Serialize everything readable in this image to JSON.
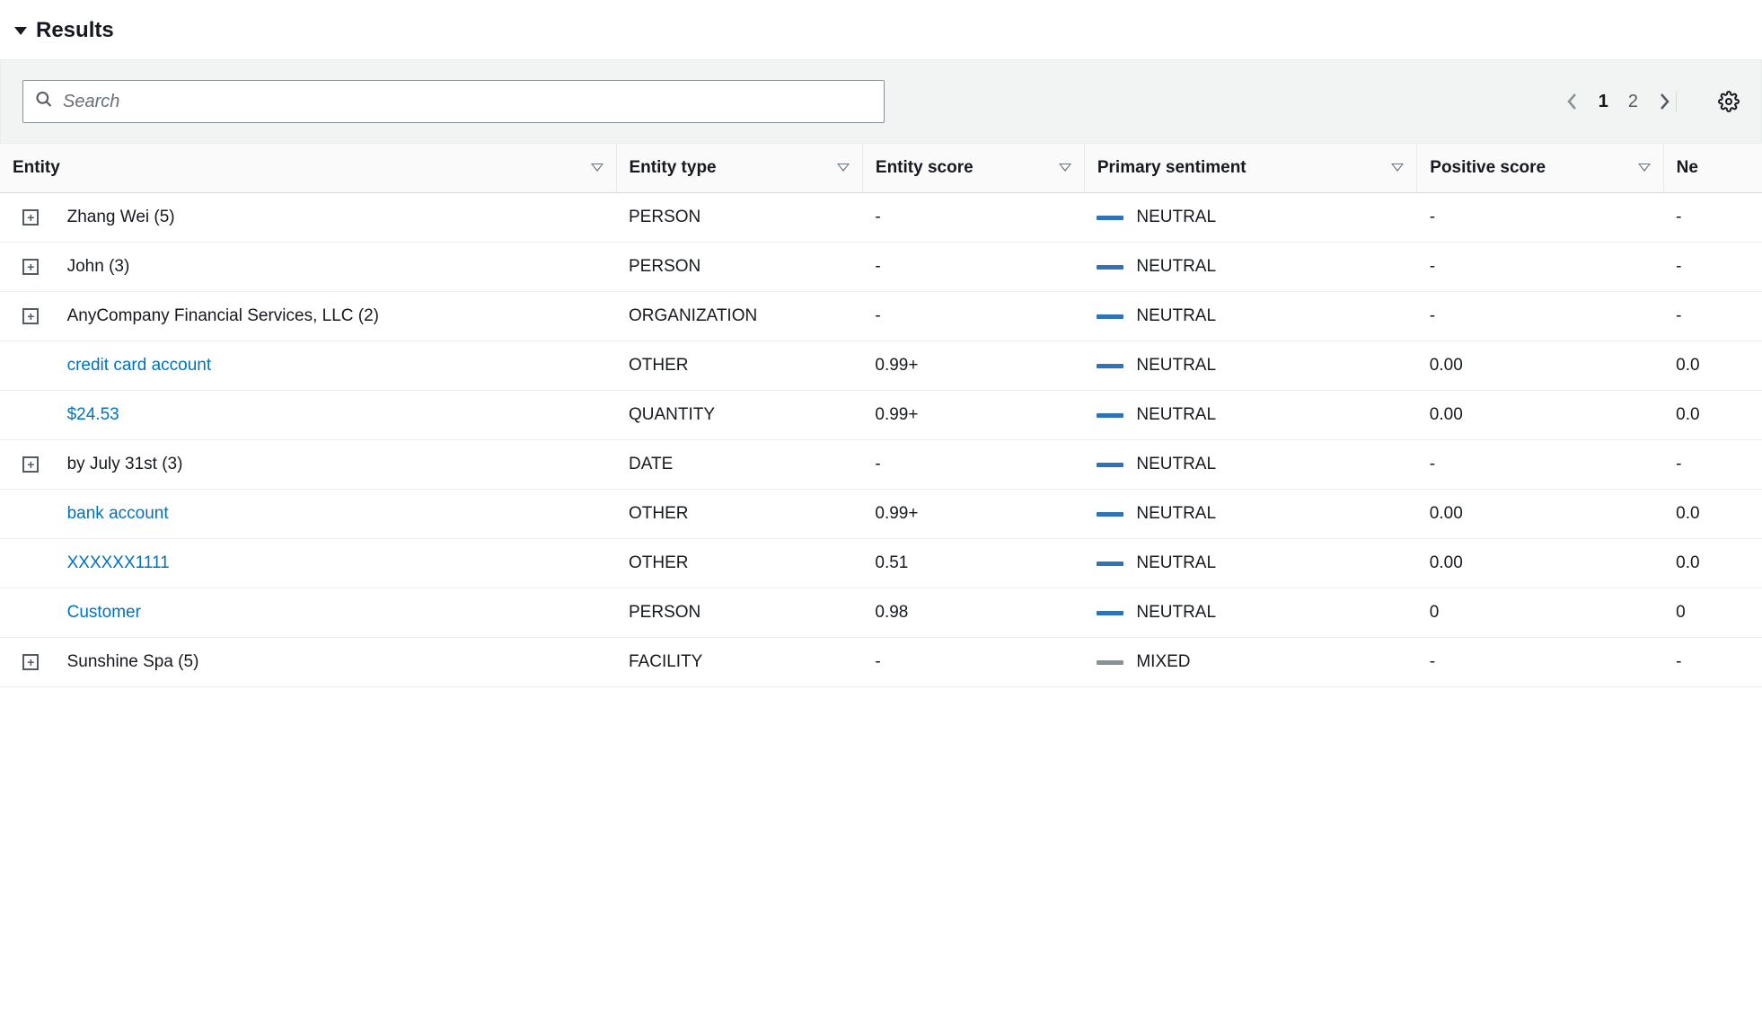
{
  "panel": {
    "title": "Results"
  },
  "search": {
    "placeholder": "Search"
  },
  "pager": {
    "current": "1",
    "other": "2"
  },
  "columns": {
    "entity": "Entity",
    "type": "Entity type",
    "score": "Entity score",
    "sentiment": "Primary sentiment",
    "positive": "Positive score",
    "negative": "Ne"
  },
  "rows": [
    {
      "expandable": true,
      "link": false,
      "entity": "Zhang Wei (5)",
      "type": "PERSON",
      "score": "-",
      "sentiment": "NEUTRAL",
      "sent_style": "neutral",
      "positive": "-",
      "negative": "-"
    },
    {
      "expandable": true,
      "link": false,
      "entity": "John (3)",
      "type": "PERSON",
      "score": "-",
      "sentiment": "NEUTRAL",
      "sent_style": "neutral",
      "positive": "-",
      "negative": "-"
    },
    {
      "expandable": true,
      "link": false,
      "entity": "AnyCompany Financial Services, LLC (2)",
      "type": "ORGANIZATION",
      "score": "-",
      "sentiment": "NEUTRAL",
      "sent_style": "neutral",
      "positive": "-",
      "negative": "-"
    },
    {
      "expandable": false,
      "link": true,
      "entity": "credit card account",
      "type": "OTHER",
      "score": "0.99+",
      "sentiment": "NEUTRAL",
      "sent_style": "neutral",
      "positive": "0.00",
      "negative": "0.0"
    },
    {
      "expandable": false,
      "link": true,
      "entity": "$24.53",
      "type": "QUANTITY",
      "score": "0.99+",
      "sentiment": "NEUTRAL",
      "sent_style": "neutral",
      "positive": "0.00",
      "negative": "0.0"
    },
    {
      "expandable": true,
      "link": false,
      "entity": "by July 31st (3)",
      "type": "DATE",
      "score": "-",
      "sentiment": "NEUTRAL",
      "sent_style": "neutral",
      "positive": "-",
      "negative": "-"
    },
    {
      "expandable": false,
      "link": true,
      "entity": "bank account",
      "type": "OTHER",
      "score": "0.99+",
      "sentiment": "NEUTRAL",
      "sent_style": "neutral",
      "positive": "0.00",
      "negative": "0.0"
    },
    {
      "expandable": false,
      "link": true,
      "entity": "XXXXXX1111",
      "type": "OTHER",
      "score": "0.51",
      "sentiment": "NEUTRAL",
      "sent_style": "neutral",
      "positive": "0.00",
      "negative": "0.0"
    },
    {
      "expandable": false,
      "link": true,
      "entity": "Customer",
      "type": "PERSON",
      "score": "0.98",
      "sentiment": "NEUTRAL",
      "sent_style": "neutral",
      "positive": "0",
      "negative": "0"
    },
    {
      "expandable": true,
      "link": false,
      "entity": "Sunshine Spa (5)",
      "type": "FACILITY",
      "score": "-",
      "sentiment": "MIXED",
      "sent_style": "mixed",
      "positive": "-",
      "negative": "-"
    }
  ]
}
